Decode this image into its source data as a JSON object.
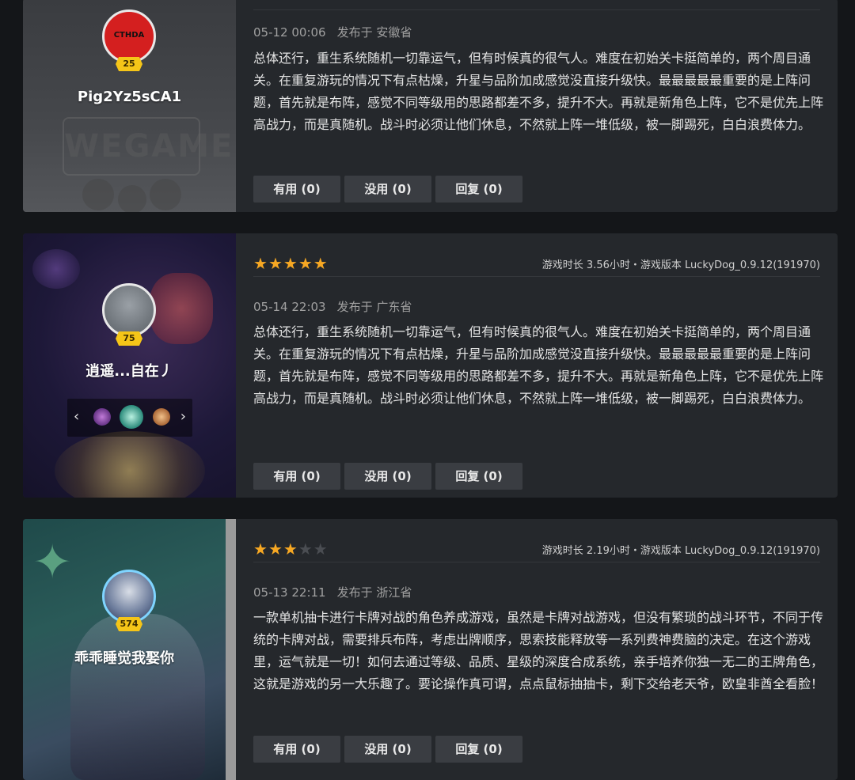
{
  "reviews": [
    {
      "avatar_text": "CTHDA",
      "level": "25",
      "username": "Pig2Yz5sCA1",
      "deco_text": "WEGAME",
      "date": "05-12 00:06",
      "location": "发布于 安徽省",
      "text": "总体还行，重生系统随机一切靠运气，但有时候真的很气人。难度在初始关卡挺简单的，两个周目通关。在重复游玩的情况下有点枯燥，升星与品阶加成感觉没直接升级快。最最最最最重要的是上阵问题，首先就是布阵，感觉不同等级用的思路都差不多，提升不大。再就是新角色上阵，它不是优先上阵高战力，而是真随机。战斗时必须让他们休息，不然就上阵一堆低级，被一脚踢死，白白浪费体力。",
      "useful": "有用 (0)",
      "useless": "没用 (0)",
      "reply": "回复 (0)"
    },
    {
      "level": "75",
      "username": "逍遥...自在丿",
      "rating": 5,
      "meta": "游戏时长 3.56小时・游戏版本 LuckyDog_0.9.12(191970)",
      "date": "05-14 22:03",
      "location": "发布于 广东省",
      "text": "总体还行，重生系统随机一切靠运气，但有时候真的很气人。难度在初始关卡挺简单的，两个周目通关。在重复游玩的情况下有点枯燥，升星与品阶加成感觉没直接升级快。最最最最最重要的是上阵问题，首先就是布阵，感觉不同等级用的思路都差不多，提升不大。再就是新角色上阵，它不是优先上阵高战力，而是真随机。战斗时必须让他们休息，不然就上阵一堆低级，被一脚踢死，白白浪费体力。",
      "useful": "有用 (0)",
      "useless": "没用 (0)",
      "reply": "回复 (0)"
    },
    {
      "level": "574",
      "username": "乖乖睡觉我娶你",
      "rating": 3,
      "meta": "游戏时长 2.19小时・游戏版本 LuckyDog_0.9.12(191970)",
      "date": "05-13 22:11",
      "location": "发布于 浙江省",
      "text": "一款单机抽卡进行卡牌对战的角色养成游戏，虽然是卡牌对战游戏，但没有繁琐的战斗环节，不同于传统的卡牌对战，需要排兵布阵，考虑出牌顺序，思索技能释放等一系列费神费脑的决定。在这个游戏里，运气就是一切！如何去通过等级、品质、星级的深度合成系统，亲手培养你独一无二的王牌角色，这就是游戏的另一大乐趣了。要论操作真可谓，点点鼠标抽抽卡，剩下交给老天爷，欧皇非酋全看脸！",
      "useful": "有用 (0)",
      "useless": "没用 (0)",
      "reply": "回复 (0)"
    }
  ],
  "badge_nav": {
    "prev": "‹",
    "next": "›"
  },
  "icons": {
    "star": "★",
    "accent_star_color": "#f7a823"
  }
}
